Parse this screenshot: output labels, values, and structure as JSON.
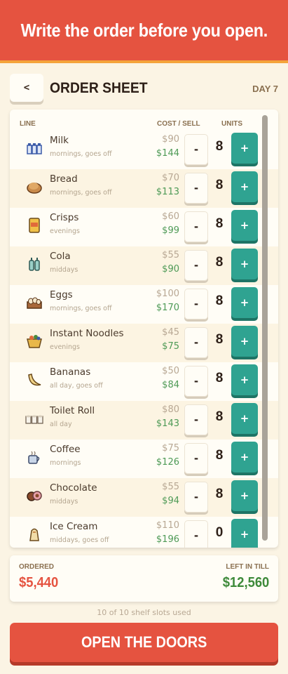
{
  "banner": {
    "text": "Write the order before you open."
  },
  "header": {
    "back_label": "<",
    "title": "ORDER SHEET",
    "day": "DAY 7"
  },
  "columns": {
    "line": "LINE",
    "cost_sell": "COST / SELL",
    "units": "UNITS"
  },
  "buttons": {
    "minus": "-",
    "plus": "+"
  },
  "items": [
    {
      "icon": "milk-icon",
      "name": "Milk",
      "note": "mornings, goes off",
      "cost": "$90",
      "sell": "$144",
      "units": "8"
    },
    {
      "icon": "bread-icon",
      "name": "Bread",
      "note": "mornings, goes off",
      "cost": "$70",
      "sell": "$113",
      "units": "8"
    },
    {
      "icon": "crisps-icon",
      "name": "Crisps",
      "note": "evenings",
      "cost": "$60",
      "sell": "$99",
      "units": "8"
    },
    {
      "icon": "cola-icon",
      "name": "Cola",
      "note": "middays",
      "cost": "$55",
      "sell": "$90",
      "units": "8"
    },
    {
      "icon": "eggs-icon",
      "name": "Eggs",
      "note": "mornings, goes off",
      "cost": "$100",
      "sell": "$170",
      "units": "8"
    },
    {
      "icon": "instant-noodles-icon",
      "name": "Instant Noodles",
      "note": "evenings",
      "cost": "$45",
      "sell": "$75",
      "units": "8"
    },
    {
      "icon": "bananas-icon",
      "name": "Bananas",
      "note": "all day, goes off",
      "cost": "$50",
      "sell": "$84",
      "units": "8"
    },
    {
      "icon": "toilet-roll-icon",
      "name": "Toilet Roll",
      "note": "all day",
      "cost": "$80",
      "sell": "$143",
      "units": "8"
    },
    {
      "icon": "coffee-icon",
      "name": "Coffee",
      "note": "mornings",
      "cost": "$75",
      "sell": "$126",
      "units": "8"
    },
    {
      "icon": "chocolate-icon",
      "name": "Chocolate",
      "note": "middays",
      "cost": "$55",
      "sell": "$94",
      "units": "8"
    },
    {
      "icon": "ice-cream-icon",
      "name": "Ice Cream",
      "note": "middays, goes off",
      "cost": "$110",
      "sell": "$196",
      "units": "0"
    }
  ],
  "summary": {
    "ordered_label": "ORDERED",
    "ordered_value": "$5,440",
    "till_label": "LEFT IN TILL",
    "till_value": "$12,560"
  },
  "slots_text": "10 of 10 shelf slots used",
  "open_button": "OPEN THE DOORS",
  "colors": {
    "banner": "#e55340",
    "accent_orange": "#f4a33a",
    "teal": "#2fa391",
    "sell_green": "#4e9a56",
    "ordered_red": "#e55340",
    "till_green": "#3e8a3a"
  }
}
